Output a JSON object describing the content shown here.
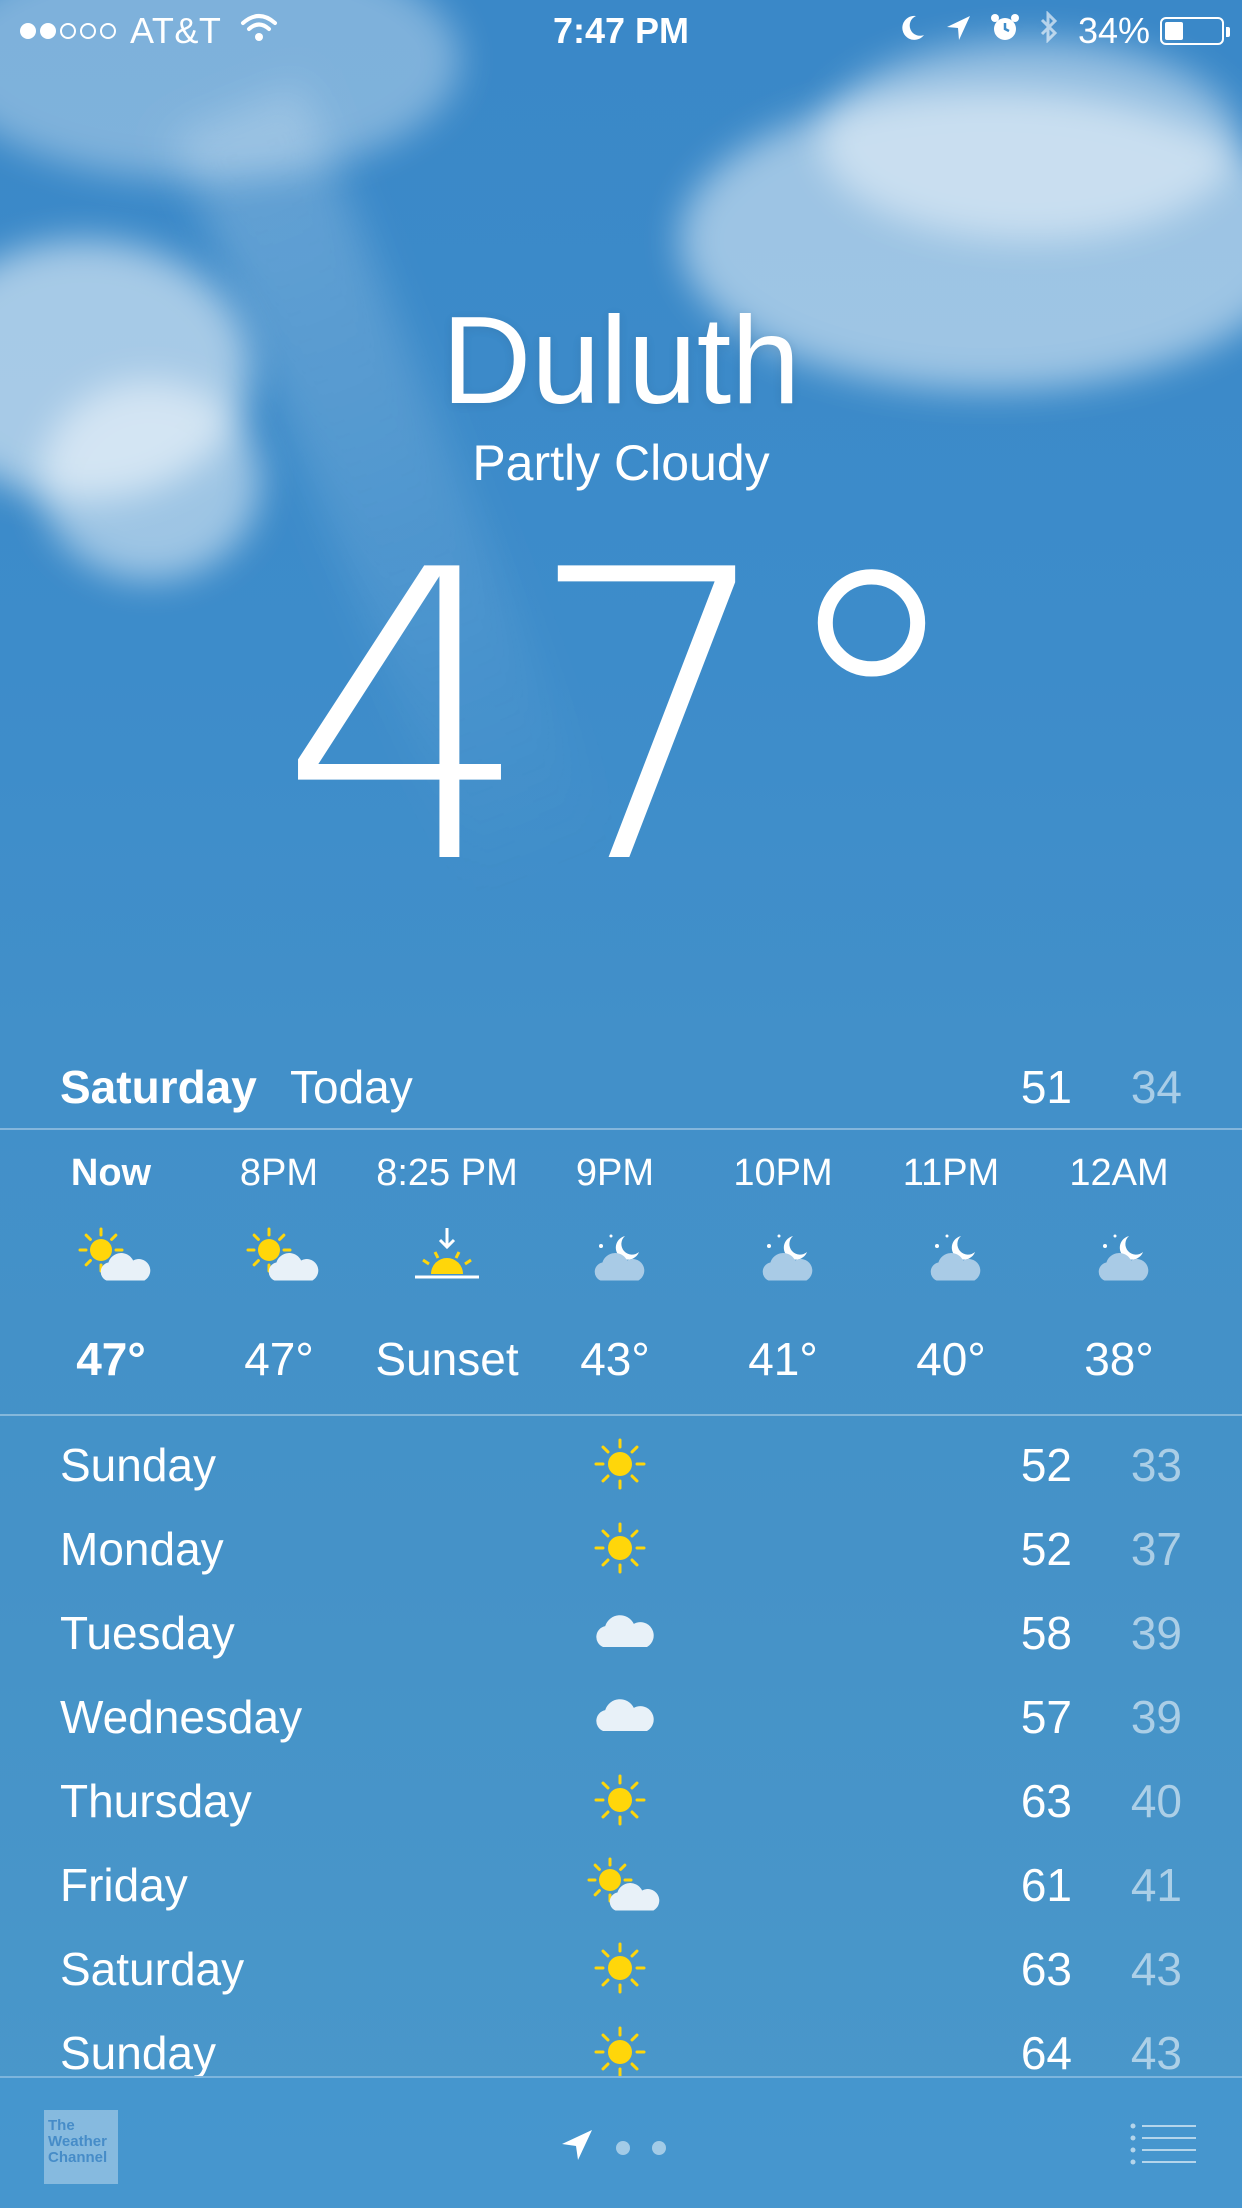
{
  "status_bar": {
    "carrier": "AT&T",
    "time": "7:47 PM",
    "battery_percent": "34%",
    "battery_level": 0.34,
    "signal_bars_filled": 2,
    "signal_bars_total": 5
  },
  "header": {
    "city": "Duluth",
    "condition": "Partly Cloudy",
    "temperature": "47°"
  },
  "today": {
    "day": "Saturday",
    "label": "Today",
    "high": "51",
    "low": "34"
  },
  "hourly": [
    {
      "time": "Now",
      "icon": "partly-cloudy-day-icon",
      "temp": "47°"
    },
    {
      "time": "8PM",
      "icon": "partly-cloudy-day-icon",
      "temp": "47°"
    },
    {
      "time": "8:25 PM",
      "icon": "sunset-icon",
      "temp": "Sunset"
    },
    {
      "time": "9PM",
      "icon": "partly-cloudy-night-icon",
      "temp": "43°"
    },
    {
      "time": "10PM",
      "icon": "partly-cloudy-night-icon",
      "temp": "41°"
    },
    {
      "time": "11PM",
      "icon": "partly-cloudy-night-icon",
      "temp": "40°"
    },
    {
      "time": "12AM",
      "icon": "partly-cloudy-night-icon",
      "temp": "38°"
    }
  ],
  "daily": [
    {
      "day": "Sunday",
      "icon": "sun-icon",
      "high": "52",
      "low": "33"
    },
    {
      "day": "Monday",
      "icon": "sun-icon",
      "high": "52",
      "low": "37"
    },
    {
      "day": "Tuesday",
      "icon": "cloud-icon",
      "high": "58",
      "low": "39"
    },
    {
      "day": "Wednesday",
      "icon": "cloud-icon",
      "high": "57",
      "low": "39"
    },
    {
      "day": "Thursday",
      "icon": "sun-icon",
      "high": "63",
      "low": "40"
    },
    {
      "day": "Friday",
      "icon": "partly-cloudy-day-icon",
      "high": "61",
      "low": "41"
    },
    {
      "day": "Saturday",
      "icon": "sun-icon",
      "high": "63",
      "low": "43"
    },
    {
      "day": "Sunday",
      "icon": "sun-icon",
      "high": "64",
      "low": "43"
    }
  ],
  "footer": {
    "logo_text": "The Weather Channel",
    "page_count": 2
  },
  "colors": {
    "sun": "#ffd60a",
    "sky": "#3d8cca",
    "low_temp": "#a9cbe6"
  }
}
